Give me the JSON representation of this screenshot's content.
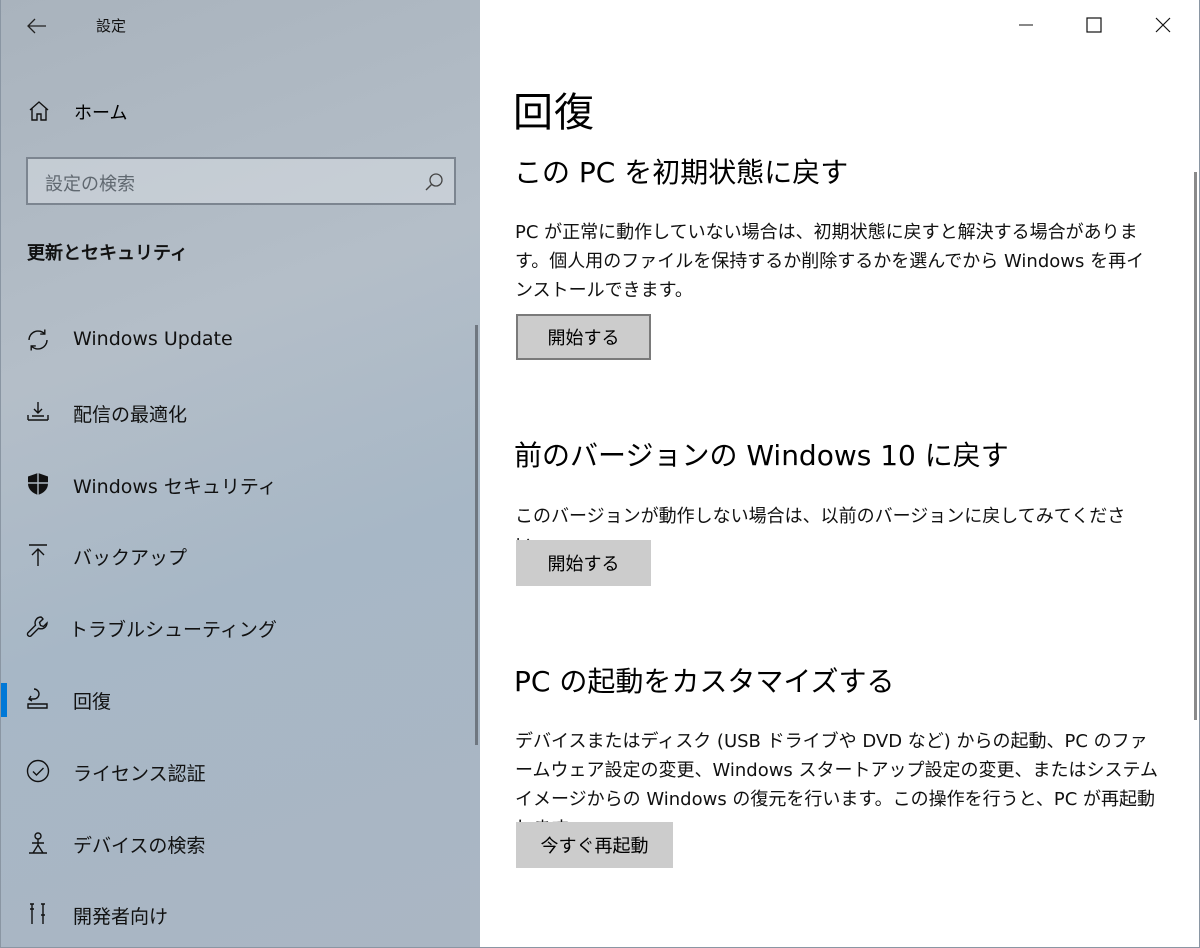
{
  "app": {
    "title": "設定"
  },
  "nav": {
    "home_label": "ホーム",
    "search_placeholder": "設定の検索",
    "section_title": "更新とセキュリティ",
    "items": [
      {
        "label": "Windows Update",
        "icon": "refresh-icon"
      },
      {
        "label": "配信の最適化",
        "icon": "delivery-icon"
      },
      {
        "label": "Windows セキュリティ",
        "icon": "shield-icon"
      },
      {
        "label": "バックアップ",
        "icon": "upload-arrow-icon"
      },
      {
        "label": "トラブルシューティング",
        "icon": "wrench-icon"
      },
      {
        "label": "回復",
        "icon": "recovery-icon",
        "active": true
      },
      {
        "label": "ライセンス認証",
        "icon": "check-circle-icon"
      },
      {
        "label": "デバイスの検索",
        "icon": "person-location-icon"
      },
      {
        "label": "開発者向け",
        "icon": "developer-icon"
      }
    ]
  },
  "main": {
    "title": "回復",
    "sections": [
      {
        "title": "この PC を初期状態に戻す",
        "desc": "PC が正常に動作していない場合は、初期状態に戻すと解決する場合があります。個人用のファイルを保持するか削除するかを選んでから Windows を再インストールできます。",
        "button": "開始する"
      },
      {
        "title": "前のバージョンの Windows 10 に戻す",
        "desc": "このバージョンが動作しない場合は、以前のバージョンに戻してみてください。",
        "button": "開始する"
      },
      {
        "title": "PC の起動をカスタマイズする",
        "desc": "デバイスまたはディスク (USB ドライブや DVD など) からの起動、PC のファームウェア設定の変更、Windows スタートアップ設定の変更、またはシステム イメージからの Windows の復元を行います。この操作を行うと、PC が再起動します。",
        "button": "今すぐ再起動"
      }
    ]
  },
  "colors": {
    "accent": "#0078d7",
    "button_bg": "#cccccc"
  }
}
